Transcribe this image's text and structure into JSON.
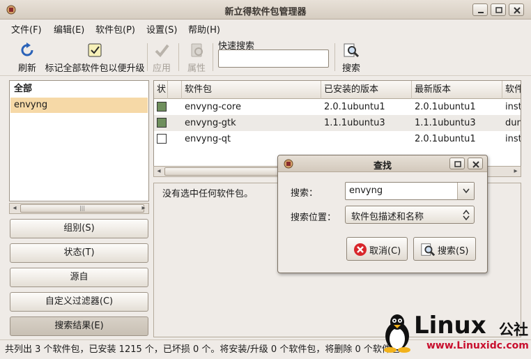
{
  "window": {
    "title": "新立得软件包管理器"
  },
  "menu": [
    "文件(F)",
    "编辑(E)",
    "软件包(P)",
    "设置(S)",
    "帮助(H)"
  ],
  "toolbar": {
    "refresh": "刷新",
    "mark_upgrades": "标记全部软件包以便升级",
    "apply": "应用",
    "properties": "属性",
    "quick_search_label": "快速搜索",
    "quick_search_value": "",
    "search": "搜索"
  },
  "left_list": {
    "header": "全部",
    "items": [
      "envyng"
    ]
  },
  "filter_buttons": [
    "组别(S)",
    "状态(T)",
    "源自",
    "自定义过滤器(C)",
    "搜索结果(E)"
  ],
  "table": {
    "columns": [
      "状",
      "",
      "软件包",
      "已安装的版本",
      "最新版本",
      "软件"
    ],
    "rows": [
      {
        "status_color": "#6f8f5d",
        "name": "envyng-core",
        "installed": "2.0.1ubuntu1",
        "latest": "2.0.1ubuntu1",
        "desc": "inst"
      },
      {
        "status_color": "#6f8f5d",
        "name": "envyng-gtk",
        "installed": "1.1.1ubuntu3",
        "latest": "1.1.1ubuntu3",
        "desc": "dun"
      },
      {
        "status_color": "#ffffff",
        "name": "envyng-qt",
        "installed": "",
        "latest": "2.0.1ubuntu1",
        "desc": "inst"
      }
    ]
  },
  "details": {
    "message": "没有选中任何软件包。"
  },
  "dialog": {
    "title": "查找",
    "search_label": "搜索：",
    "search_value": "envyng",
    "location_label": "搜索位置：",
    "location_value": "软件包描述和名称",
    "cancel": "取消(C)",
    "ok": "搜索(S)"
  },
  "status_bar": "共列出 3 个软件包，已安装 1215 个，已坏损 0 个。将安装/升级 0 个软件包，将删除 0 个软件包",
  "watermark": {
    "brand": "Linux",
    "brand_suffix": "公社",
    "url": "www.Linuxidc.com"
  },
  "colors": {
    "selection": "#f6d9a7",
    "installed_box": "#6f8f5d",
    "cancel_icon": "#d8262b",
    "watermark_url": "#c8102e"
  }
}
